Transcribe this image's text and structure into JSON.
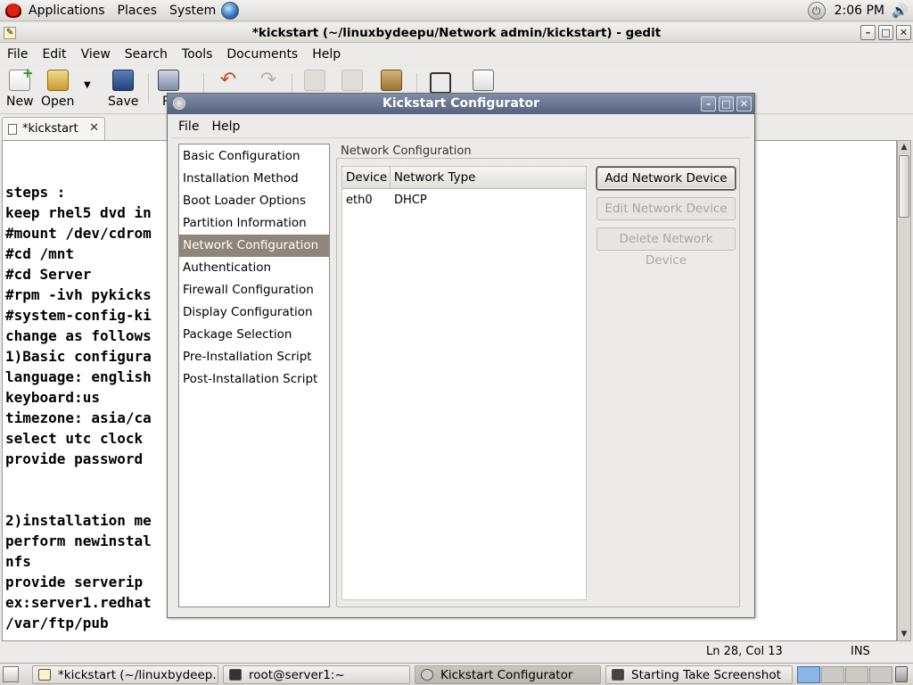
{
  "top_panel": {
    "menus": [
      "Applications",
      "Places",
      "System"
    ],
    "clock": "2:06 PM"
  },
  "gedit": {
    "window_title": "*kickstart (~/linuxbydeepu/Network admin/kickstart) - gedit",
    "menus": [
      "File",
      "Edit",
      "View",
      "Search",
      "Tools",
      "Documents",
      "Help"
    ],
    "toolbar": {
      "new": "New",
      "open": "Open",
      "save": "Save",
      "print": "Pr"
    },
    "tab_label": "*kickstart",
    "lines": [
      "",
      "",
      "steps :",
      "keep rhel5 dvd in",
      "#mount /dev/cdrom",
      "#cd /mnt",
      "#cd Server",
      "#rpm -ivh pykicks",
      "#system-config-ki",
      "change as follows",
      "1)Basic configura",
      "language: english",
      "keyboard:us",
      "timezone: asia/ca",
      "select utc clock",
      "provide password",
      "",
      "",
      "2)installation me",
      "perform newinstal",
      "nfs",
      "provide serverip",
      "ex:server1.redhat",
      "/var/ftp/pub"
    ],
    "status": {
      "position": "Ln 28, Col 13",
      "mode": "INS"
    }
  },
  "taskbar": {
    "tasks": [
      "*kickstart (~/linuxbydeep...",
      "root@server1:~",
      "Kickstart Configurator",
      "Starting Take Screenshot"
    ]
  },
  "dialog": {
    "title": "Kickstart Configurator",
    "menus": [
      "File",
      "Help"
    ],
    "nav_items": [
      "Basic Configuration",
      "Installation Method",
      "Boot Loader Options",
      "Partition Information",
      "Network Configuration",
      "Authentication",
      "Firewall Configuration",
      "Display Configuration",
      "Package Selection",
      "Pre-Installation Script",
      "Post-Installation Script"
    ],
    "selected_nav": "Network Configuration",
    "frame_label": "Network Configuration",
    "table": {
      "columns": [
        "Device",
        "Network Type"
      ],
      "rows": [
        {
          "device": "eth0",
          "type": "DHCP"
        }
      ]
    },
    "buttons": {
      "add": "Add Network Device",
      "edit": "Edit Network Device",
      "delete": "Delete Network Device"
    }
  }
}
